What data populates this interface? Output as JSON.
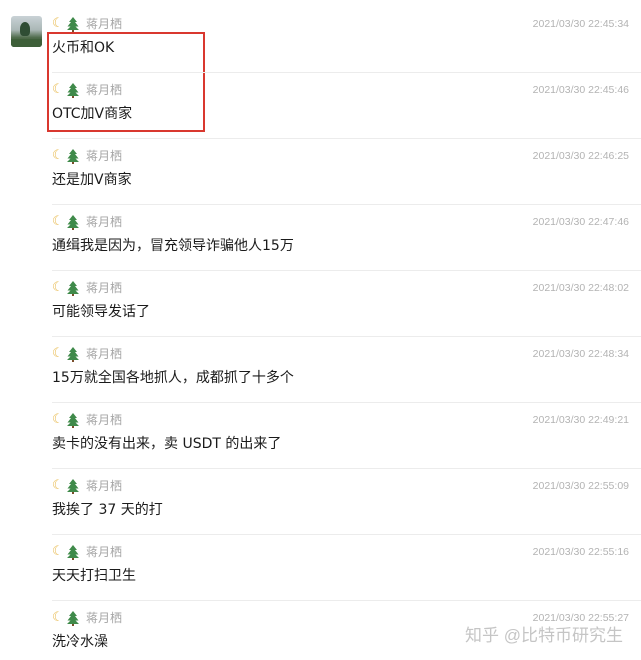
{
  "sender": {
    "name": "蒋月栖",
    "moon_icon": "crescent-moon-icon",
    "tree_icon": "evergreen-tree-icon"
  },
  "messages": [
    {
      "time": "2021/03/30 22:45:34",
      "text": "火币和OK"
    },
    {
      "time": "2021/03/30 22:45:46",
      "text": "OTC加V商家"
    },
    {
      "time": "2021/03/30 22:46:25",
      "text": "还是加V商家"
    },
    {
      "time": "2021/03/30 22:47:46",
      "text": "通缉我是因为，冒充领导诈骗他人15万"
    },
    {
      "time": "2021/03/30 22:48:02",
      "text": "可能领导发话了"
    },
    {
      "time": "2021/03/30 22:48:34",
      "text": "15万就全国各地抓人，成都抓了十多个"
    },
    {
      "time": "2021/03/30 22:49:21",
      "text": "卖卡的没有出来，卖 USDT 的出来了"
    },
    {
      "time": "2021/03/30 22:55:09",
      "text": "我挨了 37 天的打"
    },
    {
      "time": "2021/03/30 22:55:16",
      "text": "天天打扫卫生"
    },
    {
      "time": "2021/03/30 22:55:27",
      "text": "洗冷水澡"
    }
  ],
  "watermark": "知乎 @比特币研究生",
  "colors": {
    "highlight_border": "#d9382f",
    "timestamp": "#b3b3b3",
    "nickname": "#a6a6a6"
  }
}
